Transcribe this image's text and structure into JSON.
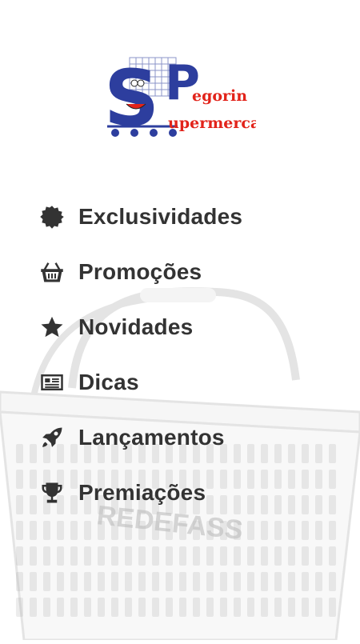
{
  "logo": {
    "initials_s": "S",
    "initials_p": "P",
    "word_top": "egorin",
    "word_bottom": "upermercado",
    "colors": {
      "blue": "#2d3e9e",
      "red": "#e2231a"
    }
  },
  "background": {
    "basket_text": "REDEFASS"
  },
  "menu": {
    "items": [
      {
        "label": "Exclusividades",
        "icon": "badge-icon"
      },
      {
        "label": "Promoções",
        "icon": "basket-icon"
      },
      {
        "label": "Novidades",
        "icon": "star-icon"
      },
      {
        "label": "Dicas",
        "icon": "newspaper-icon"
      },
      {
        "label": "Lançamentos",
        "icon": "rocket-icon"
      },
      {
        "label": "Premiações",
        "icon": "trophy-icon"
      }
    ]
  },
  "colors": {
    "text": "#333333",
    "background": "#ffffff"
  }
}
